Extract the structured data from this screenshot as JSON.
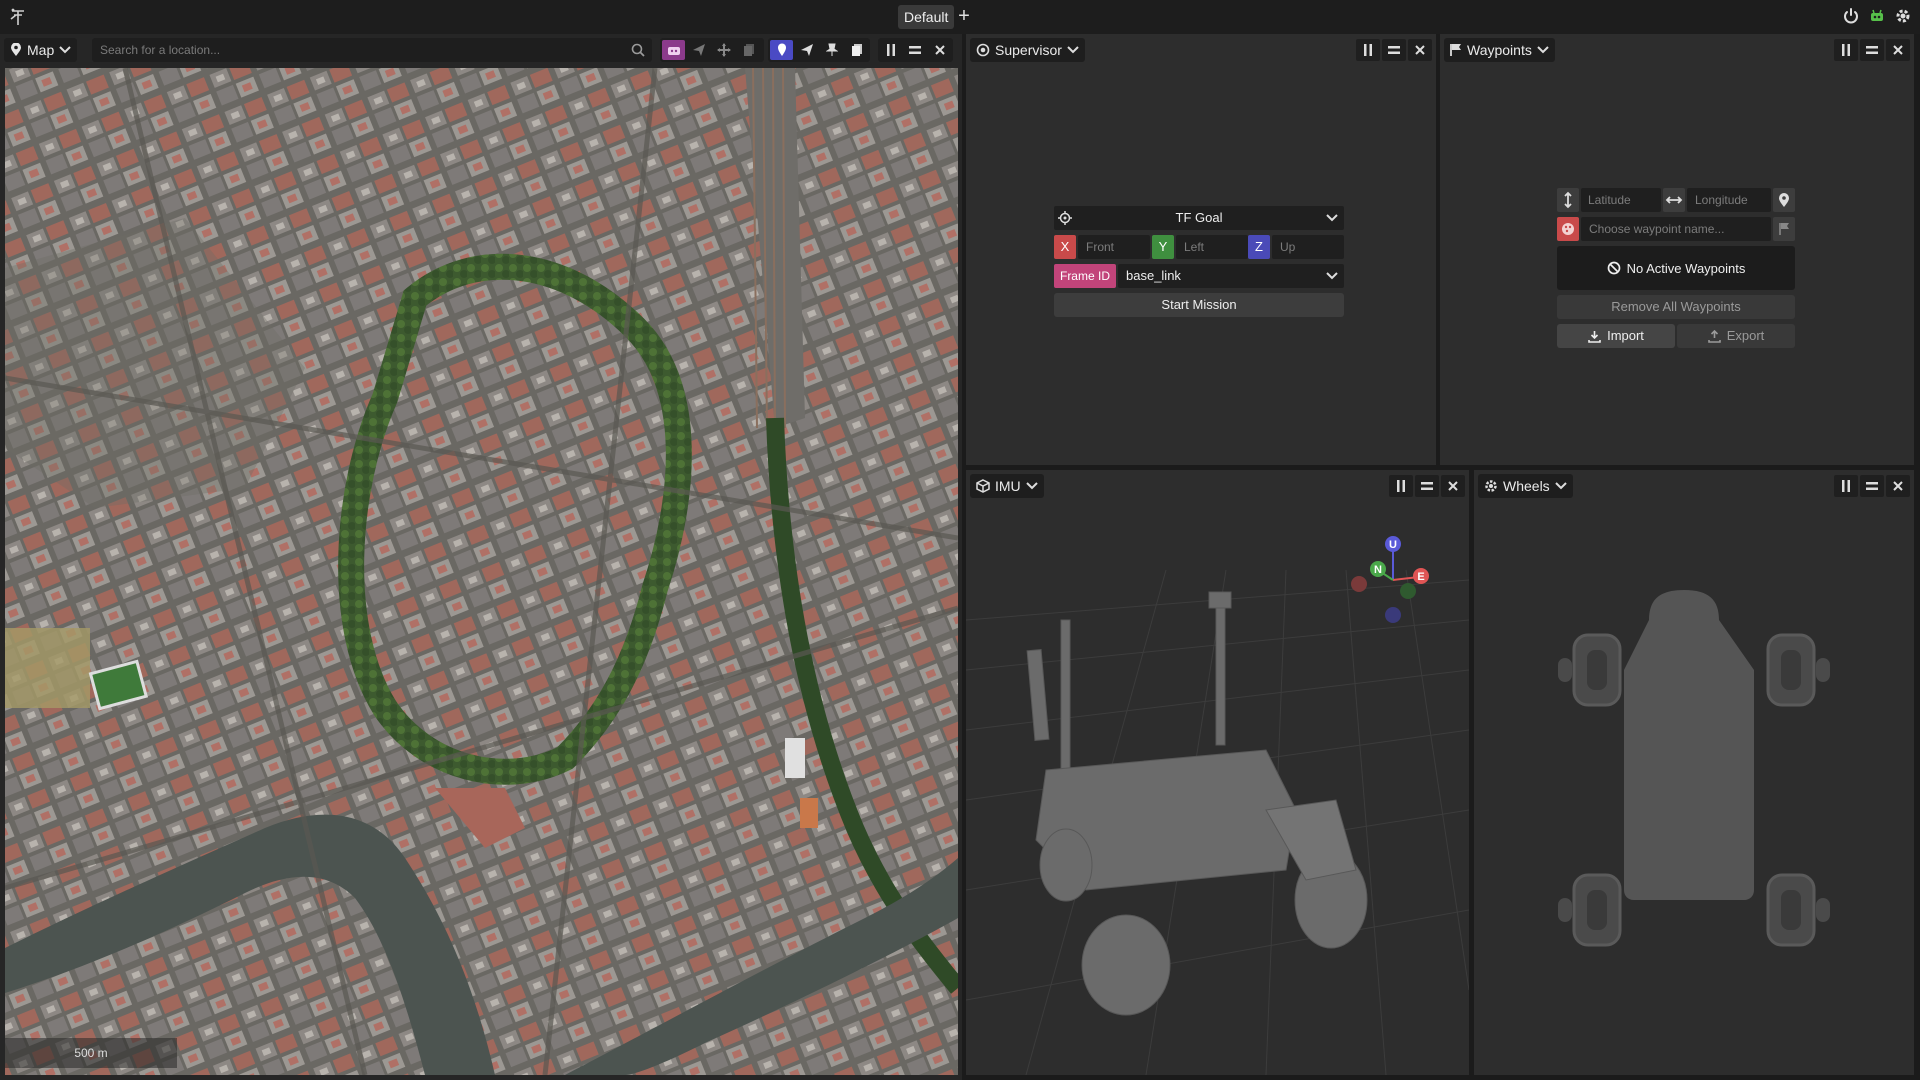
{
  "topbar": {
    "layout_tab": "Default",
    "add_label": "+"
  },
  "map_panel": {
    "title": "Map",
    "search_placeholder": "Search for a location...",
    "scale_label": "500 m"
  },
  "supervisor_panel": {
    "title": "Supervisor",
    "goal_select": "TF Goal",
    "x_label": "X",
    "x_placeholder": "Front",
    "y_label": "Y",
    "y_placeholder": "Left",
    "z_label": "Z",
    "z_placeholder": "Up",
    "frame_label": "Frame ID",
    "frame_value": "base_link",
    "start_label": "Start Mission"
  },
  "waypoints_panel": {
    "title": "Waypoints",
    "lat_placeholder": "Latitude",
    "lon_placeholder": "Longitude",
    "name_placeholder": "Choose waypoint name...",
    "status": "No Active Waypoints",
    "remove_all": "Remove All Waypoints",
    "import": "Import",
    "export": "Export"
  },
  "imu_panel": {
    "title": "IMU",
    "gizmo": {
      "up": "U",
      "north": "N",
      "east": "E"
    }
  },
  "wheels_panel": {
    "title": "Wheels"
  },
  "colors": {
    "x": "#c94a4a",
    "y": "#3f8f3f",
    "z": "#4a4ab8",
    "frame": "#c2447a",
    "accent": "#4a4ac4"
  }
}
